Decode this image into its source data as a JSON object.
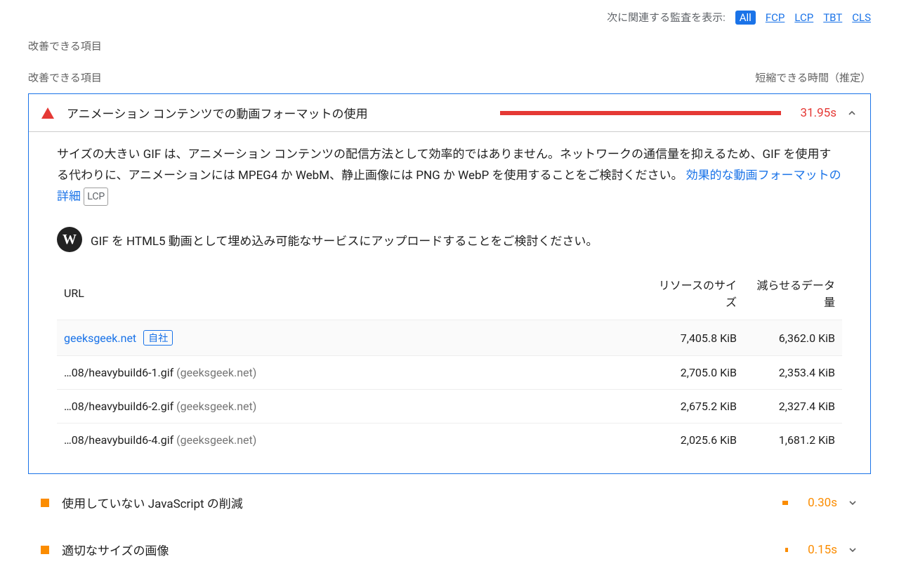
{
  "filter": {
    "label": "次に関連する監査を表示:",
    "options": [
      "All",
      "FCP",
      "LCP",
      "TBT",
      "CLS"
    ],
    "active": "All"
  },
  "section_title": "改善できる項目",
  "opportunities": {
    "column_left": "改善できる項目",
    "column_right": "短縮できる時間（推定）"
  },
  "audit_main": {
    "title": "アニメーション コンテンツでの動画フォーマットの使用",
    "metric": "31.95s",
    "bar_pct": 100,
    "description_part1": "サイズの大きい GIF は、アニメーション コンテンツの配信方法として効率的ではありません。ネットワークの通信量を抑えるため、GIF を使用する代わりに、アニメーションには MPEG4 か WebM、静止画像には PNG か WebP を使用することをご検討ください。",
    "link_text": "効果的な動画フォーマットの詳細",
    "lcp_badge": "LCP",
    "hint": "GIF を HTML5 動画として埋め込み可能なサービスにアップロードすることをご検討ください。",
    "table": {
      "headers": {
        "url": "URL",
        "size": "リソースのサイズ",
        "savings": "減らせるデータ量"
      },
      "host_row": {
        "host": "geeksgeek.net",
        "own_badge": "自社",
        "size": "7,405.8 KiB",
        "savings": "6,362.0 KiB"
      },
      "rows": [
        {
          "path": "…08/heavybuild6-1.gif",
          "host": "(geeksgeek.net)",
          "size": "2,705.0 KiB",
          "savings": "2,353.4 KiB"
        },
        {
          "path": "…08/heavybuild6-2.gif",
          "host": "(geeksgeek.net)",
          "size": "2,675.2 KiB",
          "savings": "2,327.4 KiB"
        },
        {
          "path": "…08/heavybuild6-4.gif",
          "host": "(geeksgeek.net)",
          "size": "2,025.6 KiB",
          "savings": "1,681.2 KiB"
        }
      ]
    }
  },
  "audit_js": {
    "title": "使用していない JavaScript の削減",
    "metric": "0.30s",
    "bar_pct": 2
  },
  "audit_img": {
    "title": "適切なサイズの画像",
    "metric": "0.15s",
    "bar_pct": 1
  }
}
